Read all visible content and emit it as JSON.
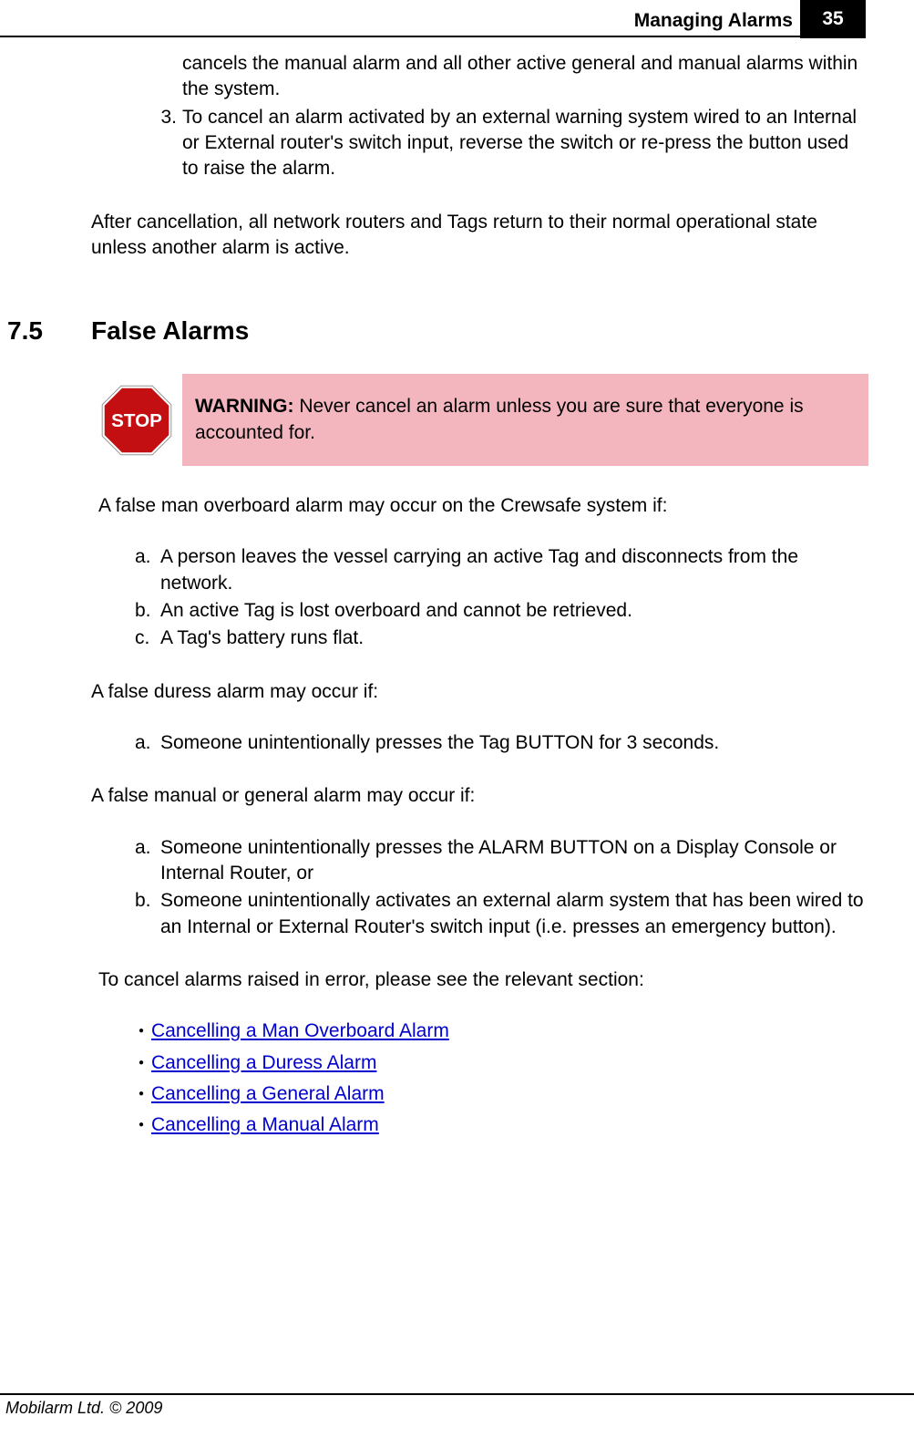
{
  "header": {
    "title": "Managing  Alarms",
    "page": "35"
  },
  "top": {
    "frag": "cancels the manual alarm and all other active general and manual alarms within the system.",
    "item3_marker": "3.",
    "item3_text": "To cancel an alarm activated by an external warning system wired to an Internal or External router's switch input, reverse the switch or re-press the button used to raise the alarm.",
    "after": "After cancellation, all network routers and Tags return to their normal operational state unless another alarm is active."
  },
  "section": {
    "num": "7.5",
    "title": "False Alarms"
  },
  "warning": {
    "label": "WARNING:",
    "text": " Never cancel an alarm unless you are sure that everyone is accounted for."
  },
  "body": {
    "p1": "A false man overboard alarm may occur on the Crewsafe system if:",
    "list1": {
      "a_m": "a.",
      "a_t": "A person leaves the vessel carrying an active Tag and disconnects from the network.",
      "b_m": "b.",
      "b_t": "An active Tag is lost overboard and cannot be retrieved.",
      "c_m": "c.",
      "c_t": "A Tag's battery runs flat."
    },
    "p2": "A false duress alarm may occur if:",
    "list2": {
      "a_m": "a.",
      "a_t": "Someone unintentionally presses the Tag BUTTON for 3 seconds."
    },
    "p3": "A false manual or general alarm may occur if:",
    "list3": {
      "a_m": "a.",
      "a_t": "Someone unintentionally presses the ALARM BUTTON on a Display Console or Internal Router, or",
      "b_m": "b.",
      "b_t": "Someone unintentionally activates an external alarm system that has been wired to an Internal or External Router's switch input (i.e. presses an emergency button)."
    },
    "p4": "To cancel alarms raised in error, please see the relevant section:"
  },
  "links": {
    "l1": "Cancelling a Man Overboard Alarm",
    "l2": "Cancelling a Duress Alarm",
    "l3": "Cancelling a General Alarm",
    "l4": "Cancelling a Manual Alarm"
  },
  "footer": {
    "text": "Mobilarm Ltd. © 2009"
  }
}
